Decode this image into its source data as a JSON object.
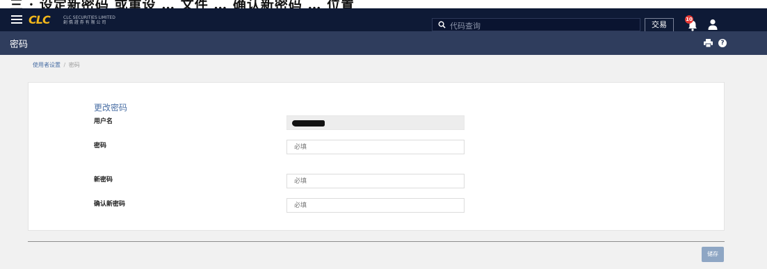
{
  "banner": {
    "text": "三 · 设定新密码 或重设 … 文件 … 确认新密码 … 位置"
  },
  "navbar": {
    "logo_text": "CLC",
    "logo_subtitle_en": "CLC SECURITIES LIMITED",
    "logo_subtitle_cn": "創 僑 證 券 有 限 公 司",
    "search_placeholder": "代码查询",
    "trade_label": "交易",
    "notification_count": "10"
  },
  "title_bar": {
    "title": "密码"
  },
  "breadcrumb": {
    "parent": "使用者设置",
    "separator": "/",
    "current": "密码"
  },
  "form": {
    "section_title": "更改密码",
    "fields": [
      {
        "label": "用户名",
        "value": "",
        "placeholder": ""
      },
      {
        "label": "密码",
        "value": "",
        "placeholder": "必填"
      },
      {
        "label": "新密码",
        "value": "",
        "placeholder": "必填"
      },
      {
        "label": "确认新密码",
        "value": "",
        "placeholder": "必填"
      }
    ]
  },
  "actions": {
    "save_label": "储存"
  },
  "colors": {
    "navbar_bg": "#0e1a36",
    "title_bar_bg": "#2f3d5d",
    "accent": "#4a6fa5",
    "logo": "#f2b71b",
    "badge": "#e53935",
    "button": "#8ea6c4"
  }
}
